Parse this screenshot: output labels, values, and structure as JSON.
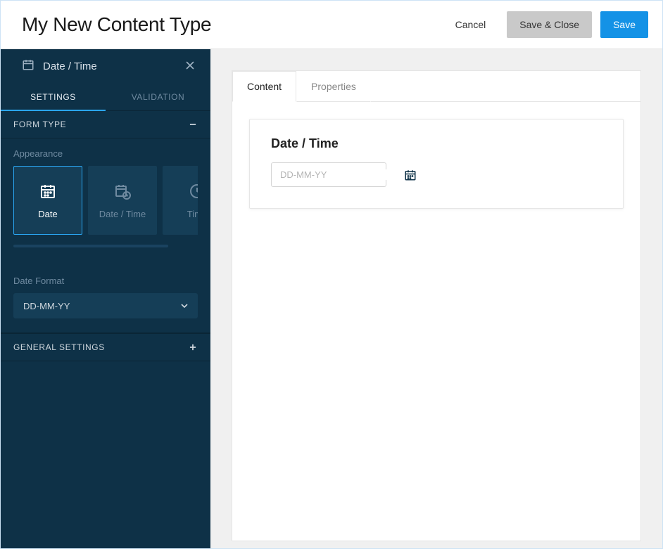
{
  "header": {
    "title": "My New Content Type",
    "cancel_label": "Cancel",
    "save_close_label": "Save & Close",
    "save_label": "Save"
  },
  "sidebar": {
    "type_title": "Date / Time",
    "tabs": {
      "settings": "SETTINGS",
      "validation": "VALIDATION"
    },
    "form_type": {
      "header": "FORM TYPE",
      "appearance_label": "Appearance",
      "options": [
        {
          "key": "date",
          "label": "Date",
          "selected": true
        },
        {
          "key": "datetime",
          "label": "Date / Time",
          "selected": false
        },
        {
          "key": "time",
          "label": "Time",
          "selected": false
        }
      ],
      "date_format_label": "Date Format",
      "date_format_value": "DD-MM-YY"
    },
    "general_settings_header": "GENERAL SETTINGS"
  },
  "preview": {
    "tabs": {
      "content": "Content",
      "properties": "Properties"
    },
    "field_title": "Date / Time",
    "date_placeholder": "DD-MM-YY"
  }
}
